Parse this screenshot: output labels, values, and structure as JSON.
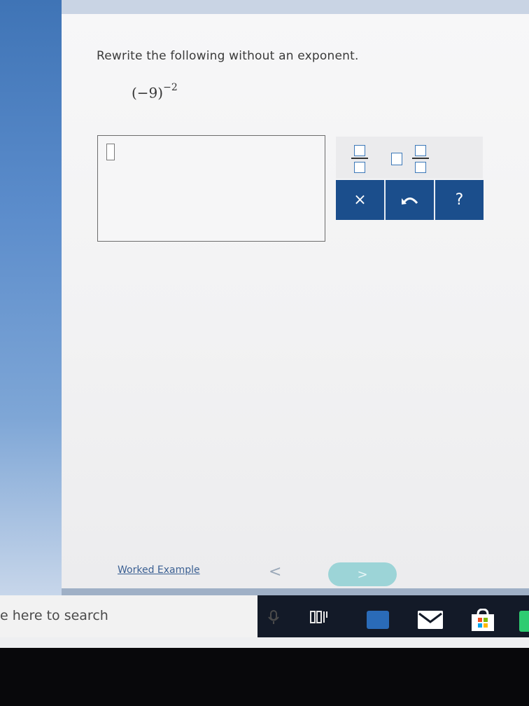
{
  "question": {
    "prompt": "Rewrite the following without an exponent.",
    "expression_base": "(−9)",
    "expression_exponent": "−2"
  },
  "toolbar": {
    "fraction_icon": "fraction-icon",
    "mixed_number_icon": "mixed-number-icon",
    "clear_label": "×",
    "undo_icon": "undo-icon",
    "help_label": "?"
  },
  "footer": {
    "worked_example": "Worked Example",
    "prev_label": "<",
    "next_label": ">"
  },
  "taskbar": {
    "search_text": "e here to search"
  },
  "colors": {
    "button_blue": "#1b4e8c",
    "next_button": "#9cd4d7",
    "link": "#3a5f92",
    "box_border": "#3c78b8"
  }
}
